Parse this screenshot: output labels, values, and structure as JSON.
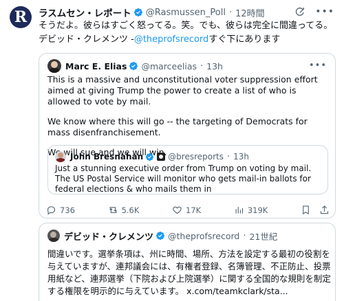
{
  "main_tweet": {
    "avatar_letter": "R",
    "name": "ラスムセン・レポート",
    "handle": "@Rasmussen_Poll",
    "separator": "·",
    "time": "12時間",
    "text_before_link": "そうだよ。彼らはすごく怒ってる。笑。でも、彼らは完全に間違ってる。デビッド・クレメンツ -",
    "link": "@theprofsrecord",
    "text_after_link": "すぐ下にあります"
  },
  "quote_tweet": {
    "name": "Marc E. Elias",
    "handle": "@marceelias",
    "separator": "·",
    "time": "13h",
    "paragraphs": [
      "This is a massive and unconstitutional voter suppression effort aimed at giving Trump the power to create a list of who is allowed to vote by mail.",
      "We know where this will go -- the targeting of Democrats for mass disenfranchisement.",
      "We will sue and we will win."
    ],
    "nested": {
      "name": "John Bresnahan",
      "handle": "@bresreports",
      "separator": "·",
      "time": "13h",
      "text": "Just a stunning executive order from Trump on voting by mail. The US Postal Service will monitor who gets mail-in ballots for federal elections & who mails them in"
    },
    "actions": {
      "replies": "736",
      "reposts": "5.6K",
      "likes": "17K",
      "views": "319K"
    }
  },
  "second_quote": {
    "name": "デビッド・クレメンツ",
    "handle": "@theprofsrecord",
    "separator": "·",
    "time": "21世紀",
    "text": "間違いです。選挙条項は、州に時間、場所、方法を設定する最初の役割を与えていますが、連邦議会には、有権者登録、名簿管理、不正防止、投票用紙など、連邦選挙（下院および上院選挙）に関する全国的な規則を制定する権限を明示的に与えています。 x.com/teamkclark/sta..."
  },
  "colors": {
    "accent": "#1d9bf0",
    "muted": "#536471",
    "border": "#cfd9de"
  },
  "icons": [
    "verified-badge-icon",
    "grok-icon",
    "more-icon",
    "reply-icon",
    "repost-icon",
    "like-icon",
    "views-icon",
    "bookmark-icon",
    "share-icon",
    "affiliate-badge-icon"
  ]
}
